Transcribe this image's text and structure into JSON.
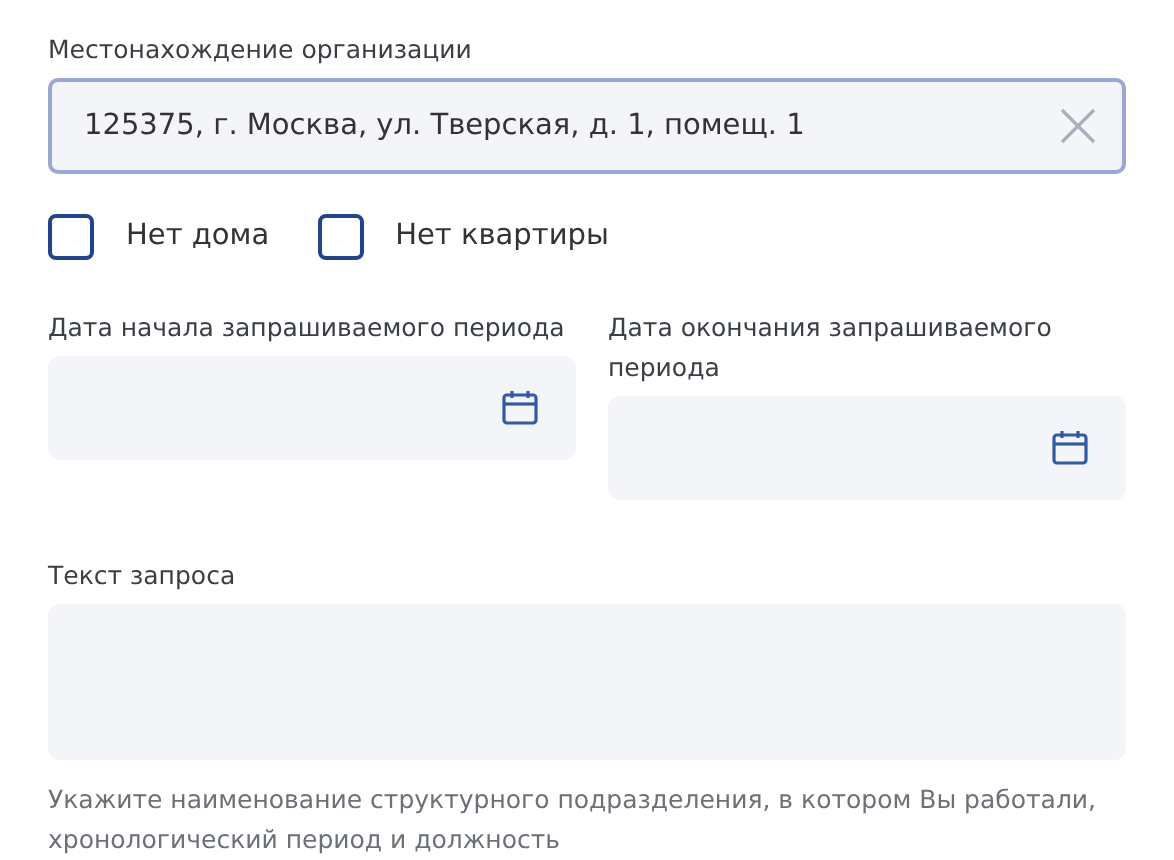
{
  "address": {
    "label": "Местонахождение организации",
    "value": "125375, г. Москва, ул. Тверская, д. 1, помещ. 1",
    "focused": true
  },
  "checkboxes": [
    {
      "label": "Нет дома",
      "checked": false
    },
    {
      "label": "Нет квартиры",
      "checked": false
    }
  ],
  "dates": [
    {
      "label": "Дата начала запрашиваемого периода"
    },
    {
      "label": "Дата окончания запрашиваемого периода"
    }
  ],
  "request": {
    "label": "Текст запроса",
    "hint": "Укажите наименование структурного подразделения, в котором Вы работали, хронологический период и должность"
  }
}
